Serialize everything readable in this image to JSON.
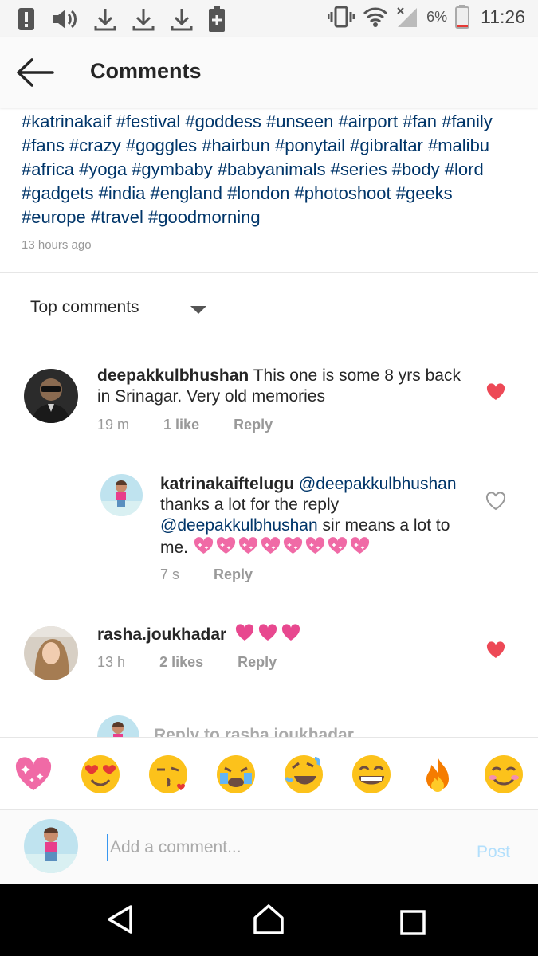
{
  "status_bar": {
    "battery_percent": "6%",
    "time": "11:26",
    "left_icons": [
      "alert-icon",
      "volume-icon",
      "download-icon",
      "download-icon",
      "download-icon",
      "battery-plus-icon"
    ],
    "right_icons": [
      "vibrate-icon",
      "wifi-icon",
      "signal-icon",
      "battery-icon"
    ]
  },
  "header": {
    "title": "Comments",
    "back_icon": "back-arrow-icon"
  },
  "caption": {
    "hashtags": "#katrinakaif #festival #goddess #unseen #airport #fan #fanily #fans #crazy #goggles #hairbun #ponytail #gibraltar #malibu #africa #yoga #gymbaby #babyanimals #series #body #lord #gadgets #india #england #london #photoshoot #geeks #europe #travel #goodmorning",
    "time": "13 hours ago"
  },
  "sort": {
    "label": "Top comments"
  },
  "comments": [
    {
      "username": "deepakkulbhushan",
      "text": "This one is some 8 yrs back in Srinagar. Very old memories",
      "time": "19 m",
      "likes": "1 like",
      "reply": "Reply",
      "liked": true
    },
    {
      "username": "katrinakaiftelugu",
      "mention1": "@deepakkulbhushan",
      "text1": "thanks a lot for the reply",
      "mention2": "@deepakkulbhushan",
      "text2": "sir means a lot to me.",
      "emoji_count": 8,
      "time": "7 s",
      "reply": "Reply",
      "liked": false
    },
    {
      "username": "rasha.joukhadar",
      "heart_count": 3,
      "time": "13 h",
      "likes": "2 likes",
      "reply": "Reply",
      "liked": true
    }
  ],
  "partial_reply": {
    "text": "Reply to rasha.joukhadar..."
  },
  "emoji_bar": [
    "sparkling-heart",
    "heart-eyes",
    "kissing-face",
    "crying-face",
    "laughing-face",
    "grinning-face",
    "fire",
    "smiling-face"
  ],
  "composer": {
    "placeholder": "Add a comment...",
    "post_label": "Post"
  },
  "nav": [
    "back-triangle-icon",
    "home-icon",
    "recents-icon"
  ],
  "colors": {
    "link": "#003569",
    "heart_liked": "#ed4956",
    "post_disabled": "#b2dffc",
    "meta": "#999999"
  }
}
